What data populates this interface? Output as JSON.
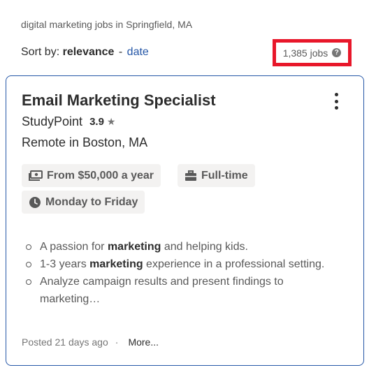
{
  "search": {
    "query_text": "digital marketing jobs in Springfield, MA",
    "sort_label": "Sort by:",
    "sort_active": "relevance",
    "sort_separator": "-",
    "sort_alt": "date",
    "job_count": "1,385 jobs",
    "help_icon": "?"
  },
  "job": {
    "title": "Email Marketing Specialist",
    "company": "StudyPoint",
    "rating": "3.9",
    "rating_icon": "★",
    "location": "Remote in Boston, MA",
    "salary": "From $50,000 a year",
    "type": "Full-time",
    "schedule": "Monday to Friday",
    "snippet": [
      {
        "pre": "A passion for ",
        "bold": "marketing",
        "post": " and helping kids."
      },
      {
        "pre": "1-3 years ",
        "bold": "marketing",
        "post": " experience in a professional setting."
      },
      {
        "pre": "Analyze campaign results and present findings to marketing…",
        "bold": "",
        "post": ""
      }
    ],
    "posted": "Posted 21 days ago",
    "footer_sep": "·",
    "more": "More..."
  },
  "icons": {
    "salary": "money-icon",
    "type": "briefcase-icon",
    "schedule": "clock-icon",
    "menu": "more-vertical-icon"
  },
  "colors": {
    "link": "#2557a7",
    "highlight_box": "#e8172a",
    "card_border": "#2557a7",
    "chip_bg": "#f3f2f1"
  }
}
